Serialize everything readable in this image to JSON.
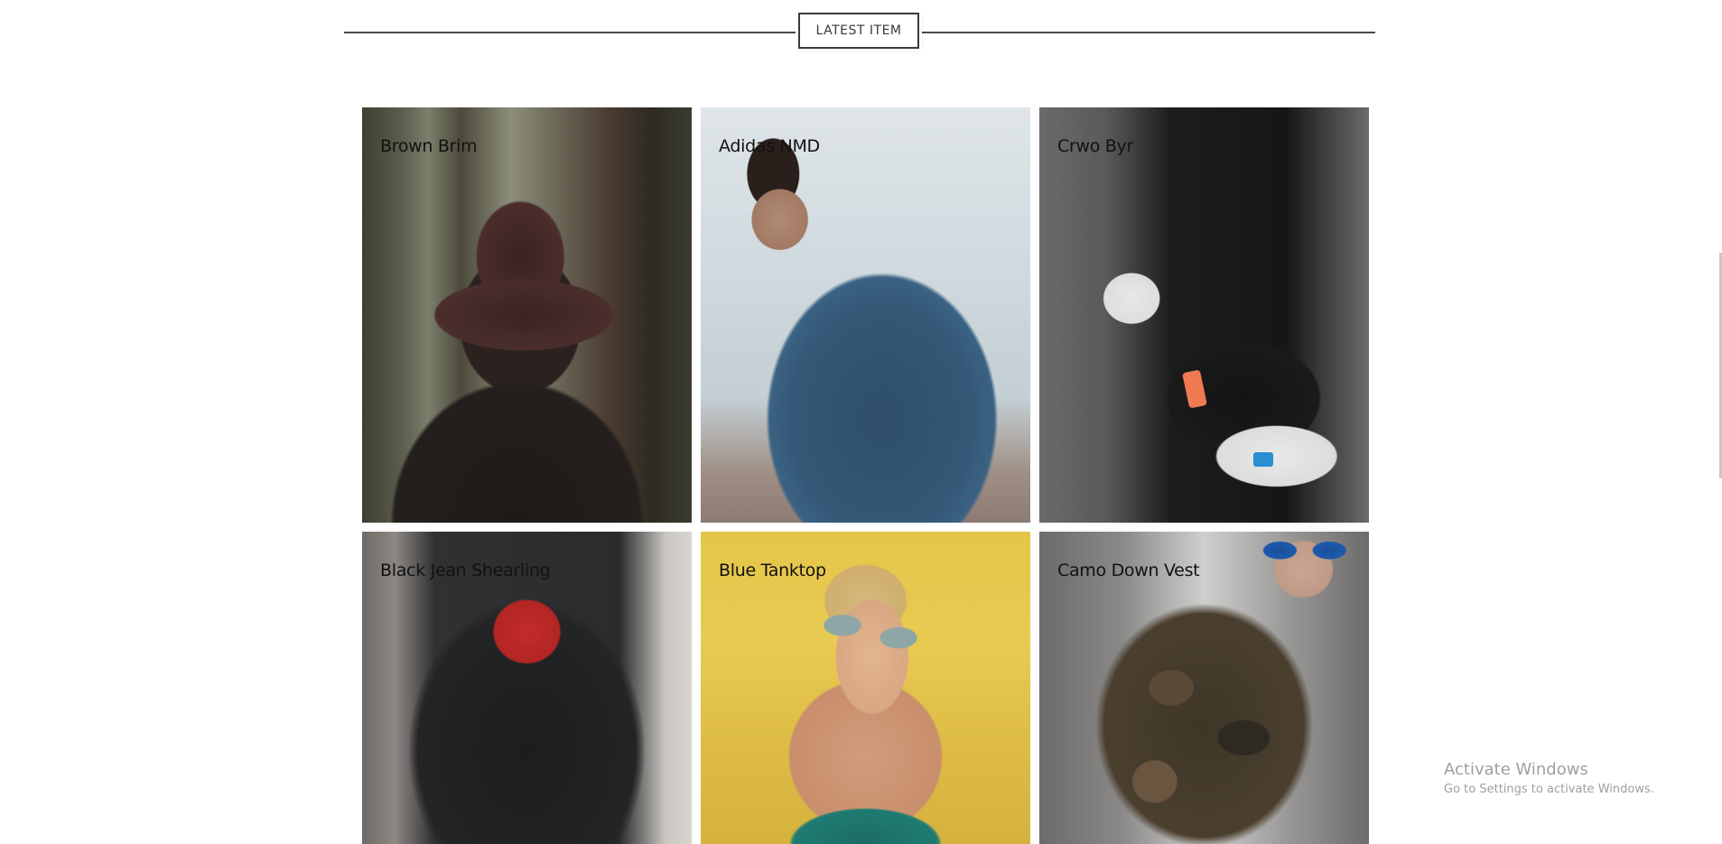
{
  "section": {
    "title": "LATEST ITEM"
  },
  "products": [
    {
      "name": "Brown Brim"
    },
    {
      "name": "Adidas NMD"
    },
    {
      "name": "Crwo Byr"
    },
    {
      "name": "Black Jean Shearling"
    },
    {
      "name": "Blue Tanktop"
    },
    {
      "name": "Camo Down Vest"
    }
  ],
  "watermark": {
    "title": "Activate Windows",
    "subtitle": "Go to Settings to activate Windows."
  },
  "colors": {
    "line": "#4a4a4a",
    "title_border": "#3a3a3a",
    "label_text": "#111111",
    "watermark_text": "#a0a0a0"
  }
}
